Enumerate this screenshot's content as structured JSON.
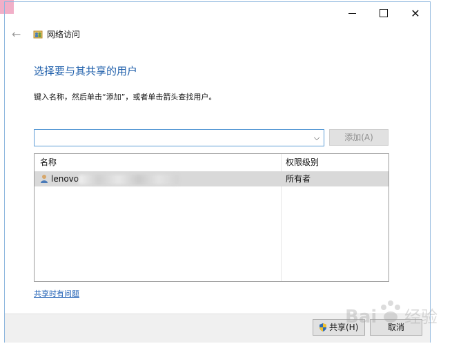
{
  "window": {
    "nav_title": "网络访问",
    "icons": {
      "back": "back-arrow-icon",
      "nav": "network-users-icon",
      "minimize": "minimize-icon",
      "maximize": "maximize-icon",
      "close": "close-icon"
    }
  },
  "page": {
    "heading": "选择要与其共享的用户",
    "instruction": "键入名称，然后单击“添加”，或者单击箭头查找用户。"
  },
  "input": {
    "value": "",
    "placeholder": ""
  },
  "buttons": {
    "add_label": "添加(A)",
    "share_label": "共享(H)",
    "cancel_label": "取消"
  },
  "table": {
    "columns": [
      "名称",
      "权限级别"
    ],
    "rows": [
      {
        "name": "lenovo",
        "permission": "所有者"
      }
    ]
  },
  "link": {
    "text": "共享时有问题"
  },
  "watermark": {
    "text": "Baidu经验"
  },
  "colors": {
    "accent": "#1f5fab",
    "link": "#1a5cb3",
    "input_border": "#5a9bd5",
    "selected_row": "#d9d9d9"
  }
}
